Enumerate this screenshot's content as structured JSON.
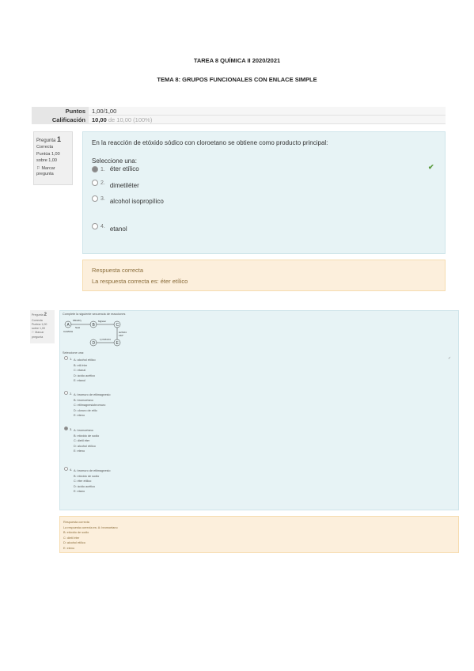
{
  "header": {
    "title": "TAREA 8 QUÍMICA II 2020/2021",
    "subtitle": "TEMA 8: GRUPOS FUNCIONALES CON ENLACE SIMPLE"
  },
  "summary": {
    "points_label": "Puntos",
    "points_value": "1,00/1,00",
    "grade_label": "Calificación",
    "grade_value": "10,00",
    "grade_rest": "de 10,00 (100%)"
  },
  "q1": {
    "info_prefix": "Pregunta",
    "number": "1",
    "status": "Correcta",
    "score": "Puntúa 1,00 sobre 1,00",
    "flag": "Marcar pregunta",
    "text": "En la reacción de etóxido sódico con cloroetano se obtiene como producto principal:",
    "select_label": "Seleccione una:",
    "options": [
      {
        "letter": "1.",
        "text": "éter etílico"
      },
      {
        "letter": "2.",
        "text": "dimetiléter"
      },
      {
        "letter": "3.",
        "text": "alcohol isopropílico"
      },
      {
        "letter": "4.",
        "text": "etanol"
      }
    ],
    "feedback_title": "Respuesta correcta",
    "feedback_answer": "La respuesta correcta es: éter etílico"
  },
  "q2": {
    "info_prefix": "Pregunta",
    "number": "2",
    "status": "Correcta",
    "score": "Puntúa 1,00 sobre 1,00",
    "flag": "Marcar pregunta",
    "text": "Complete la siguiente secuencia de reacciones",
    "scheme": {
      "A": "A",
      "B": "B",
      "C": "C",
      "D": "D",
      "E": "E",
      "r1_top": "PBr3/Py",
      "r1_bottom": "NaH",
      "r1_left": "C2H5OH",
      "r2_top": "Mg/éter",
      "r3_right": "H2SO4",
      "r3_right2": "160°",
      "r4_top": "1) KMnO4"
    },
    "select_label": "Seleccione una:",
    "options": [
      {
        "letter": "1.",
        "lines": [
          "A: alcohol etílico",
          "B: etil éter",
          "C: etanal",
          "D: ácido acético",
          "E: etanol"
        ]
      },
      {
        "letter": "2.",
        "lines": [
          "A: bromuro de etilmagnesio",
          "B: bromoetano",
          "C: etilmagnesiobromuro",
          "D: cloruro de etilo",
          "E: eteno"
        ]
      },
      {
        "letter": "3.",
        "lines": [
          "A: bromoetano",
          "B: etóxido de sodio",
          "C: dietil éter",
          "D: alcohol etílico",
          "E: eteno"
        ]
      },
      {
        "letter": "4.",
        "lines": [
          "A: bromuro de etilmagnesio",
          "B: etóxido de sodio",
          "C: éter etílico",
          "D: ácido acético",
          "E: etano"
        ]
      }
    ],
    "feedback": [
      "Respuesta correcta",
      "La respuesta correcta es: A: bromoetano",
      "B: etóxido de sodio",
      "C: dietil éter",
      "D: alcohol etílico",
      "E: eteno"
    ]
  },
  "colors": {
    "question_bg": "#e7f3f5",
    "feedback_bg": "#fcefdc",
    "correct_check": "#5a9a3c"
  },
  "icons": {
    "check": "check-icon",
    "radio": "radio-icon"
  }
}
